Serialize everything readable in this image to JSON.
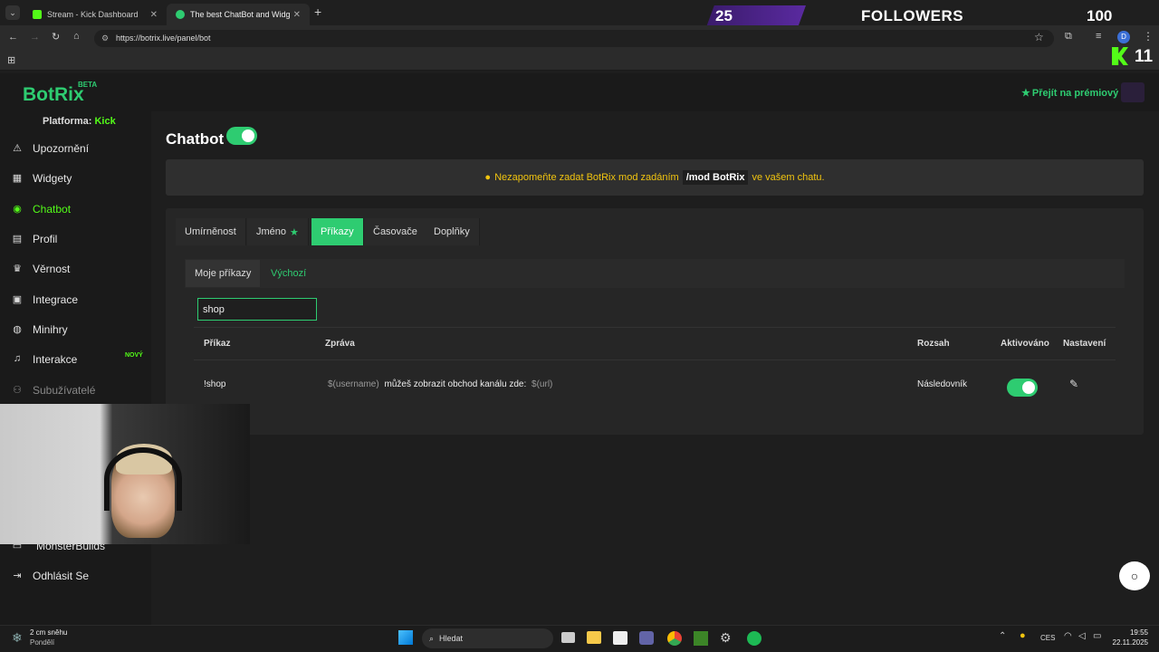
{
  "browser": {
    "tabs": [
      {
        "label": "Stream - Kick Dashboard",
        "active": false
      },
      {
        "label": "The best ChatBot and Widgets",
        "active": true
      }
    ],
    "url": "https://botrix.live/panel/bot",
    "profile_initial": "D"
  },
  "overlay": {
    "count_left": "25",
    "label": "FOLLOWERS",
    "count_right": "100",
    "kick_count": "11"
  },
  "app": {
    "logo": "BotRix",
    "logo_badge": "BETA",
    "platform_label": "Platforma:",
    "platform_value": "Kick",
    "premium_link": "Přejít na prémiový",
    "sidebar": [
      {
        "label": "Upozornění",
        "icon": "warning-icon"
      },
      {
        "label": "Widgety",
        "icon": "grid-icon"
      },
      {
        "label": "Chatbot",
        "icon": "robot-icon",
        "active": true
      },
      {
        "label": "Profil",
        "icon": "profile-card-icon"
      },
      {
        "label": "Věrnost",
        "icon": "trophy-icon"
      },
      {
        "label": "Integrace",
        "icon": "integration-icon"
      },
      {
        "label": "Minihry",
        "icon": "gamepad-icon"
      },
      {
        "label": "Interakce",
        "icon": "music-icon",
        "badge": "NOVÝ"
      },
      {
        "label": "Subužívatelé",
        "icon": "users-icon"
      },
      {
        "label": "MonsterBuilds",
        "icon": "monitor-icon"
      },
      {
        "label": "Odhlásit Se",
        "icon": "logout-icon"
      }
    ],
    "page_title": "Chatbot",
    "notice_prefix": "Nezapomeňte zadat BotRix mod zadáním",
    "notice_code": "/mod BotRix",
    "notice_suffix": "ve vašem chatu.",
    "tabs": [
      "Umírněnost",
      "Jméno",
      "Příkazy",
      "Časovače",
      "Doplňky"
    ],
    "active_tab": "Příkazy",
    "subtabs": [
      "Moje příkazy",
      "Výchozí"
    ],
    "search_value": "shop",
    "table": {
      "headers": [
        "Příkaz",
        "Zpráva",
        "Rozsah",
        "Aktivováno",
        "Nastavení"
      ],
      "rows": [
        {
          "command": "!shop",
          "msg_var1": "$(username)",
          "msg_text": "můžeš zobrazit obchod kanálu zde:",
          "msg_var2": "$(url)",
          "scope": "Následovník",
          "enabled": true
        }
      ]
    }
  },
  "taskbar": {
    "weather": "2 cm sněhu",
    "weather_sub": "Pondělí",
    "search": "Hledat",
    "lang": "CES",
    "time": "19:55",
    "date": "22.11.2025"
  },
  "colors": {
    "accent": "#2ecc71",
    "kick_green": "#53fc18",
    "notice_text": "#f1c40f"
  }
}
